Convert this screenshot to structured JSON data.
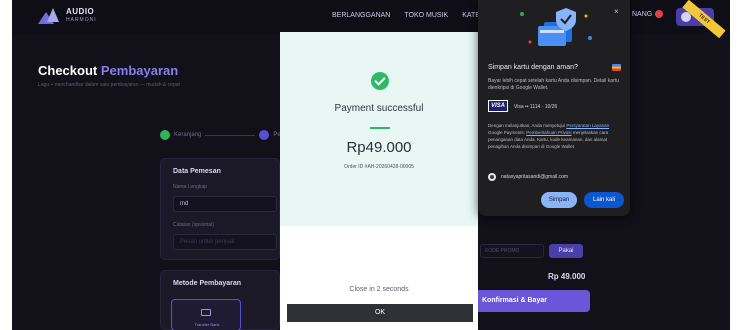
{
  "nav": {
    "logo_line1": "AUDIO",
    "logo_line2": "HARMONI",
    "links": [
      "BERLANGGANAN",
      "TOKO MUSIK",
      "KATEGO"
    ],
    "right_text": "NANG",
    "badge_color": "#e0404c",
    "test_ribbon": "TEST"
  },
  "checkout": {
    "title_plain": "Checkout",
    "title_accent": "Pembayaran",
    "subtitle": "Lagu + merchandise dalam satu pembayaran — mudah & cepat",
    "step1": "Keranjang",
    "step2_number": "2",
    "step2_label": "Pe",
    "order_card_title": "Data Pemesan",
    "name_label": "Nama Lengkap",
    "name_value": "md",
    "note_label": "Catatan (opsional)",
    "note_placeholder": "Pesan untuk penjual",
    "payment_card_title": "Metode Pembayaran",
    "pay_tile_label": "Transfer Bank",
    "promo_placeholder": "KODE PROMO",
    "promo_button": "Pakai",
    "total": "Rp 49.000",
    "confirm_button": "Konfirmasi & Bayar"
  },
  "modal": {
    "status": "Payment successful",
    "amount": "Rp49.000",
    "order_id": "Order ID #AH-20260428-00005",
    "close_text": "Close in 2 seconds",
    "ok_button": "OK",
    "accent_color": "#2fb86a"
  },
  "wallet": {
    "close_glyph": "×",
    "title": "Simpan kartu dengan aman?",
    "description": "Bayar lebih cepat setelah kartu Anda disimpan. Detail kartu dienkripsi di Google Wallet.",
    "card_brand": "VISA",
    "card_text": "Visa •• 1114  ·  10/26",
    "legal_prefix": "Dengan melanjutkan, Anda menyetujui ",
    "legal_link1": "Persyaratan Layanan",
    "legal_mid": " Google Payments. ",
    "legal_link2": "Pemberitahuan Privasi",
    "legal_suffix": " menjelaskan cara penanganan data Anda. Kartu, kode keamanan, dan alamat penagihan Anda disimpan di Google Wallet.",
    "account_email": "natasyapritasandi@gmail.com",
    "save_button": "Simpan",
    "later_button": "Lain kali"
  }
}
